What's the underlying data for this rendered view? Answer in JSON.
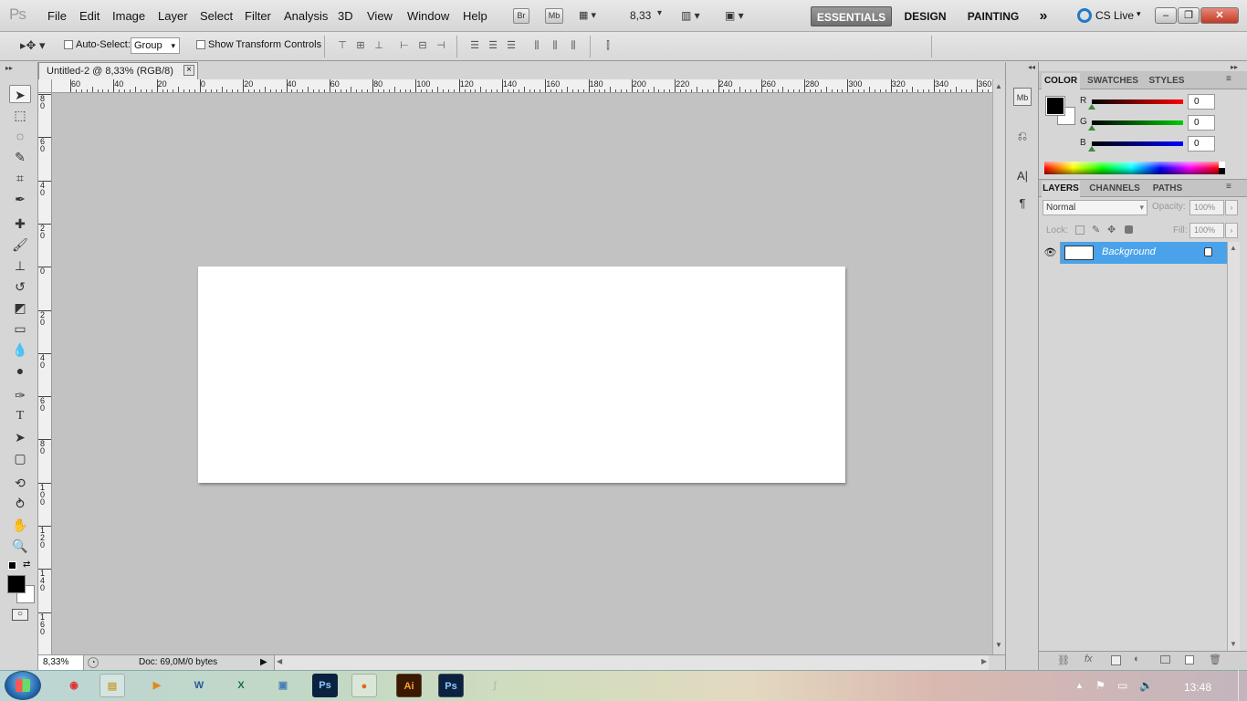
{
  "app": {
    "logo": "Ps"
  },
  "menu": [
    "File",
    "Edit",
    "Image",
    "Layer",
    "Select",
    "Filter",
    "Analysis",
    "3D",
    "View",
    "Window",
    "Help"
  ],
  "menubar_tools": {
    "bridge": "Br",
    "minibridge": "Mb",
    "zoom": "8,33"
  },
  "workspaces": [
    "ESSENTIALS",
    "DESIGN",
    "PAINTING"
  ],
  "workspace_more": "»",
  "cs_live": "CS Live",
  "options": {
    "auto_select_label": "Auto-Select:",
    "auto_select_value": "Group",
    "transform_label": "Show Transform Controls"
  },
  "document": {
    "tab_title": "Untitled-2 @ 8,33% (RGB/8)",
    "close": "×",
    "zoom_status": "8,33%",
    "doc_info": "Doc: 69,0M/0 bytes"
  },
  "ruler_h": [
    "60",
    "40",
    "20",
    "0",
    "20",
    "40",
    "60",
    "80",
    "100",
    "120",
    "140",
    "160",
    "180",
    "200",
    "220",
    "240",
    "260",
    "280",
    "300",
    "320",
    "340",
    "360"
  ],
  "ruler_v": [
    "8\n0",
    "6\n0",
    "4\n0",
    "2\n0",
    "0",
    "2\n0",
    "4\n0",
    "6\n0",
    "8\n0",
    "1\n0\n0",
    "1\n2\n0",
    "1\n4\n0",
    "1\n6\n0"
  ],
  "color_panel": {
    "tabs": [
      "COLOR",
      "SWATCHES",
      "STYLES"
    ],
    "r_label": "R",
    "g_label": "G",
    "b_label": "B",
    "r": "0",
    "g": "0",
    "b": "0"
  },
  "layers_panel": {
    "tabs": [
      "LAYERS",
      "CHANNELS",
      "PATHS"
    ],
    "blend_mode": "Normal",
    "opacity_label": "Opacity:",
    "opacity": "100%",
    "lock_label": "Lock:",
    "fill_label": "Fill:",
    "fill": "100%",
    "layers": [
      {
        "name": "Background"
      }
    ]
  },
  "taskbar": {
    "apps": [
      "Chrome",
      "Explorer",
      "Media",
      "Word",
      "Excel",
      "Photos",
      "Ps",
      "Firefox",
      "Ai",
      "Ps",
      ""
    ],
    "time": "13:48"
  },
  "colors": {
    "selection": "#4aa3ea",
    "canvas": "#ffffff",
    "workspace": "#c2c2c2"
  }
}
